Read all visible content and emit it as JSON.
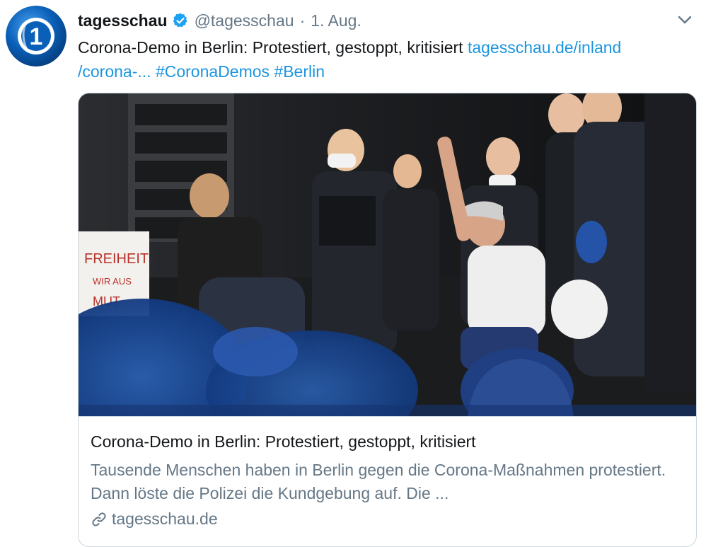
{
  "tweet": {
    "display_name": "tagesschau",
    "handle": "@tagesschau",
    "separator": "·",
    "date": "1. Aug.",
    "text": "Corona-Demo in Berlin: Protestiert, gestoppt, kritisiert",
    "link_part1": "tagesschau.de/inland",
    "link_part2": "/corona-...",
    "hashtag1": "#CoronaDemos",
    "hashtag2": "#Berlin",
    "avatar_logo_text": "1"
  },
  "card": {
    "image_sign_line1": "FREIHEIT",
    "image_sign_line2": "WIR AUS",
    "image_sign_line3": "MUT",
    "title": "Corona-Demo in Berlin: Protestiert, gestoppt, kritisiert",
    "description": "Tausende Menschen haben in Berlin gegen die Corona-Maßnahmen protestiert. Dann löste die Polizei die Kundgebung auf. Die ...",
    "domain": "tagesschau.de"
  },
  "colors": {
    "link": "#1b95e0",
    "secondary_text": "#657786",
    "verified_badge": "#1da1f2",
    "avatar_blue": "#0a5fb8"
  },
  "icons": {
    "avatar": "ard-logo-icon",
    "verified": "verified-badge-icon",
    "menu": "chevron-down-icon",
    "domain": "link-icon"
  }
}
